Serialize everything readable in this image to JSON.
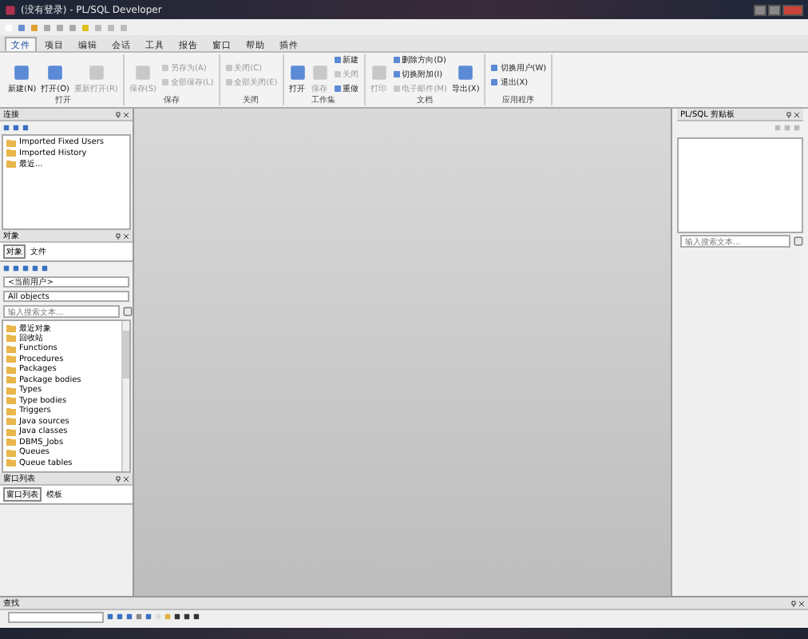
{
  "window": {
    "title": "(没有登录) - PL/SQL Developer"
  },
  "menu_tabs": [
    {
      "label": "文件",
      "selected": true
    },
    {
      "label": "项目",
      "selected": false
    },
    {
      "label": "编辑",
      "selected": false
    },
    {
      "label": "会话",
      "selected": false
    },
    {
      "label": "工具",
      "selected": false
    },
    {
      "label": "报告",
      "selected": false
    },
    {
      "label": "窗口",
      "selected": false
    },
    {
      "label": "帮助",
      "selected": false
    },
    {
      "label": "插件",
      "selected": false
    }
  ],
  "ribbon_groups": [
    {
      "title": "打开",
      "items": [
        {
          "label": "新建(N)",
          "kind": "large",
          "disabled": false
        },
        {
          "label": "打开(O)",
          "kind": "large",
          "disabled": false
        },
        {
          "label": "重新打开(R)",
          "kind": "large",
          "disabled": true
        }
      ]
    },
    {
      "title": "保存",
      "items": [
        {
          "label": "保存(S)",
          "kind": "large",
          "disabled": true
        },
        {
          "label": "另存为(A)",
          "kind": "small",
          "disabled": true
        },
        {
          "label": "全部保存(L)",
          "kind": "small",
          "disabled": true
        }
      ]
    },
    {
      "title": "关闭",
      "items": [
        {
          "label": "关闭(C)",
          "kind": "small",
          "disabled": true
        },
        {
          "label": "全部关闭(E)",
          "kind": "small",
          "disabled": true
        }
      ]
    },
    {
      "title": "工作集",
      "items": [
        {
          "label": "打开",
          "kind": "large",
          "disabled": false
        },
        {
          "label": "保存",
          "kind": "large",
          "disabled": true
        },
        {
          "label": "新建",
          "kind": "small",
          "disabled": false
        },
        {
          "label": "关闭",
          "kind": "small",
          "disabled": true
        },
        {
          "label": "重做",
          "kind": "small",
          "disabled": false
        }
      ]
    },
    {
      "title": "文档",
      "items": [
        {
          "label": "打印",
          "kind": "large",
          "disabled": true
        },
        {
          "label": "删除方向(D)",
          "kind": "small",
          "disabled": false
        },
        {
          "label": "切换附加(I)",
          "kind": "small",
          "disabled": false
        },
        {
          "label": "电子邮件(M)",
          "kind": "small",
          "disabled": true
        },
        {
          "label": "导出(X)",
          "kind": "large",
          "disabled": false
        }
      ]
    },
    {
      "title": "应用程序",
      "items": [
        {
          "label": "切换用户(W)",
          "kind": "small",
          "disabled": false
        },
        {
          "label": "退出(X)",
          "kind": "small",
          "disabled": false
        }
      ]
    }
  ],
  "connections_panel": {
    "title": "连接",
    "tree": [
      {
        "label": "Imported Fixed Users"
      },
      {
        "label": "Imported History"
      },
      {
        "label": "最近..."
      }
    ]
  },
  "objects_panel": {
    "title": "对象",
    "tabs": [
      {
        "label": "对象",
        "selected": true
      },
      {
        "label": "文件",
        "selected": false
      }
    ],
    "user_select": "<当前用户>",
    "filter_select": "All objects",
    "search": {
      "placeholder": "输入搜索文本..."
    },
    "tree": [
      {
        "label": "最近对象"
      },
      {
        "label": "回收站"
      },
      {
        "label": "Functions"
      },
      {
        "label": "Procedures"
      },
      {
        "label": "Packages"
      },
      {
        "label": "Package bodies"
      },
      {
        "label": "Types"
      },
      {
        "label": "Type bodies"
      },
      {
        "label": "Triggers"
      },
      {
        "label": "Java sources"
      },
      {
        "label": "Java classes"
      },
      {
        "label": "DBMS_Jobs"
      },
      {
        "label": "Queues"
      },
      {
        "label": "Queue tables"
      }
    ]
  },
  "windows_panel": {
    "title": "窗口列表",
    "tabs": [
      {
        "label": "窗口列表",
        "selected": true
      },
      {
        "label": "模板",
        "selected": false
      }
    ]
  },
  "clipboard_panel": {
    "title": "PL/SQL 剪贴板",
    "search": {
      "placeholder": "输入搜索文本..."
    }
  },
  "find_panel": {
    "title": "查找"
  }
}
